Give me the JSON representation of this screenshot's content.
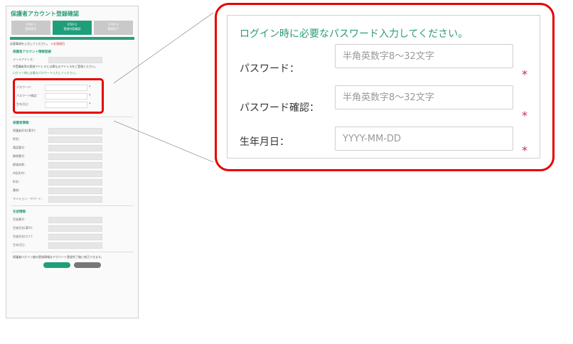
{
  "thumbnail": {
    "title": "保護者アカウント登録確認",
    "steps": [
      {
        "label": "STEP-1",
        "sub": "登録受付"
      },
      {
        "label": "STEP-2",
        "sub": "登録内容確認"
      },
      {
        "label": "STEP-3",
        "sub": "登録完了"
      }
    ],
    "required_note": "必要事項を入力してください。",
    "required_mark": "＊必須項目",
    "section_account": "保護者アカウント情報登録",
    "email_label": "メールアドレス：",
    "email_note": "※受講者用の登録アドレスとは異なるアドレスをご登録ください。",
    "login_note": "ログイン時に必要なパスワード入力してください。",
    "pw_label": "パスワード：",
    "pw_confirm_label": "パスワード確認：",
    "dob_label": "生年月日：",
    "section_guardian": "保護者情報",
    "guardian_fields": [
      "保護者氏名(漢字)：",
      "性別：",
      "電話番号：",
      "郵便番号：",
      "都道府県：",
      "市区町村：",
      "町名：",
      "番地：",
      "マンション・アパート："
    ],
    "section_student": "生徒情報",
    "student_fields": [
      "生徒番号：",
      "生徒氏名(漢字)：",
      "生徒氏名(カナ)：",
      "生年月日："
    ],
    "footer_note": "保護者ログイン後の登録情報はアカウント登録完了後に修正できます。",
    "btn_primary": "登録",
    "btn_secondary": "戻る"
  },
  "zoom": {
    "instruction": "ログイン時に必要なパスワード入力してください。",
    "password_label": "パスワード：",
    "password_placeholder": "半角英数字8～32文字",
    "password_confirm_label": "パスワード確認：",
    "password_confirm_placeholder": "半角英数字8～32文字",
    "dob_label": "生年月日：",
    "dob_placeholder": "YYYY-MM-DD",
    "required_mark": "*"
  },
  "colors": {
    "accent_green": "#2a9d78",
    "highlight_red": "#e60000",
    "required_pink": "#c0306a"
  }
}
